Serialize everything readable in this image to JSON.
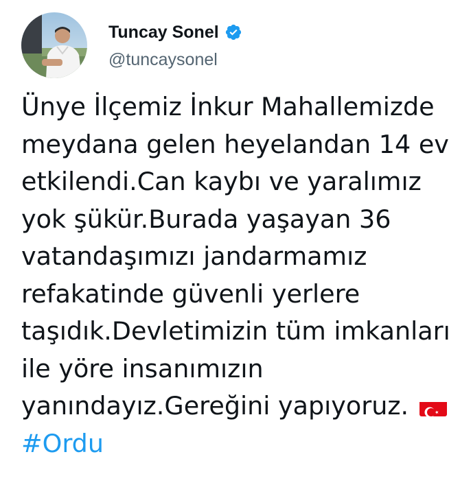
{
  "author": {
    "display_name": "Tuncay Sonel",
    "handle": "@tuncaysonel",
    "verified": true,
    "avatar_icon": "profile-photo"
  },
  "tweet": {
    "lines": [
      "Ünye İlçemiz İnkur Mahallemizde",
      "meydana gelen heyelandan 14 ev",
      "etkilendi.Can kaybı ve yaralımız",
      "yok şükür.Burada yaşayan 36",
      "vatandaşımızı jandarmamız",
      "refakatinde güvenli yerlere",
      "taşıdık.Devletimizin tüm imkanları",
      "ile yöre insanımızın",
      "yanındayız.Gereğini yapıyoruz."
    ],
    "flag_icon": "turkey-flag-icon",
    "hashtag": "#Ordu"
  },
  "colors": {
    "text": "#0f1419",
    "secondary": "#536471",
    "accent": "#1d9bf0",
    "flag_red": "#e30a17"
  }
}
